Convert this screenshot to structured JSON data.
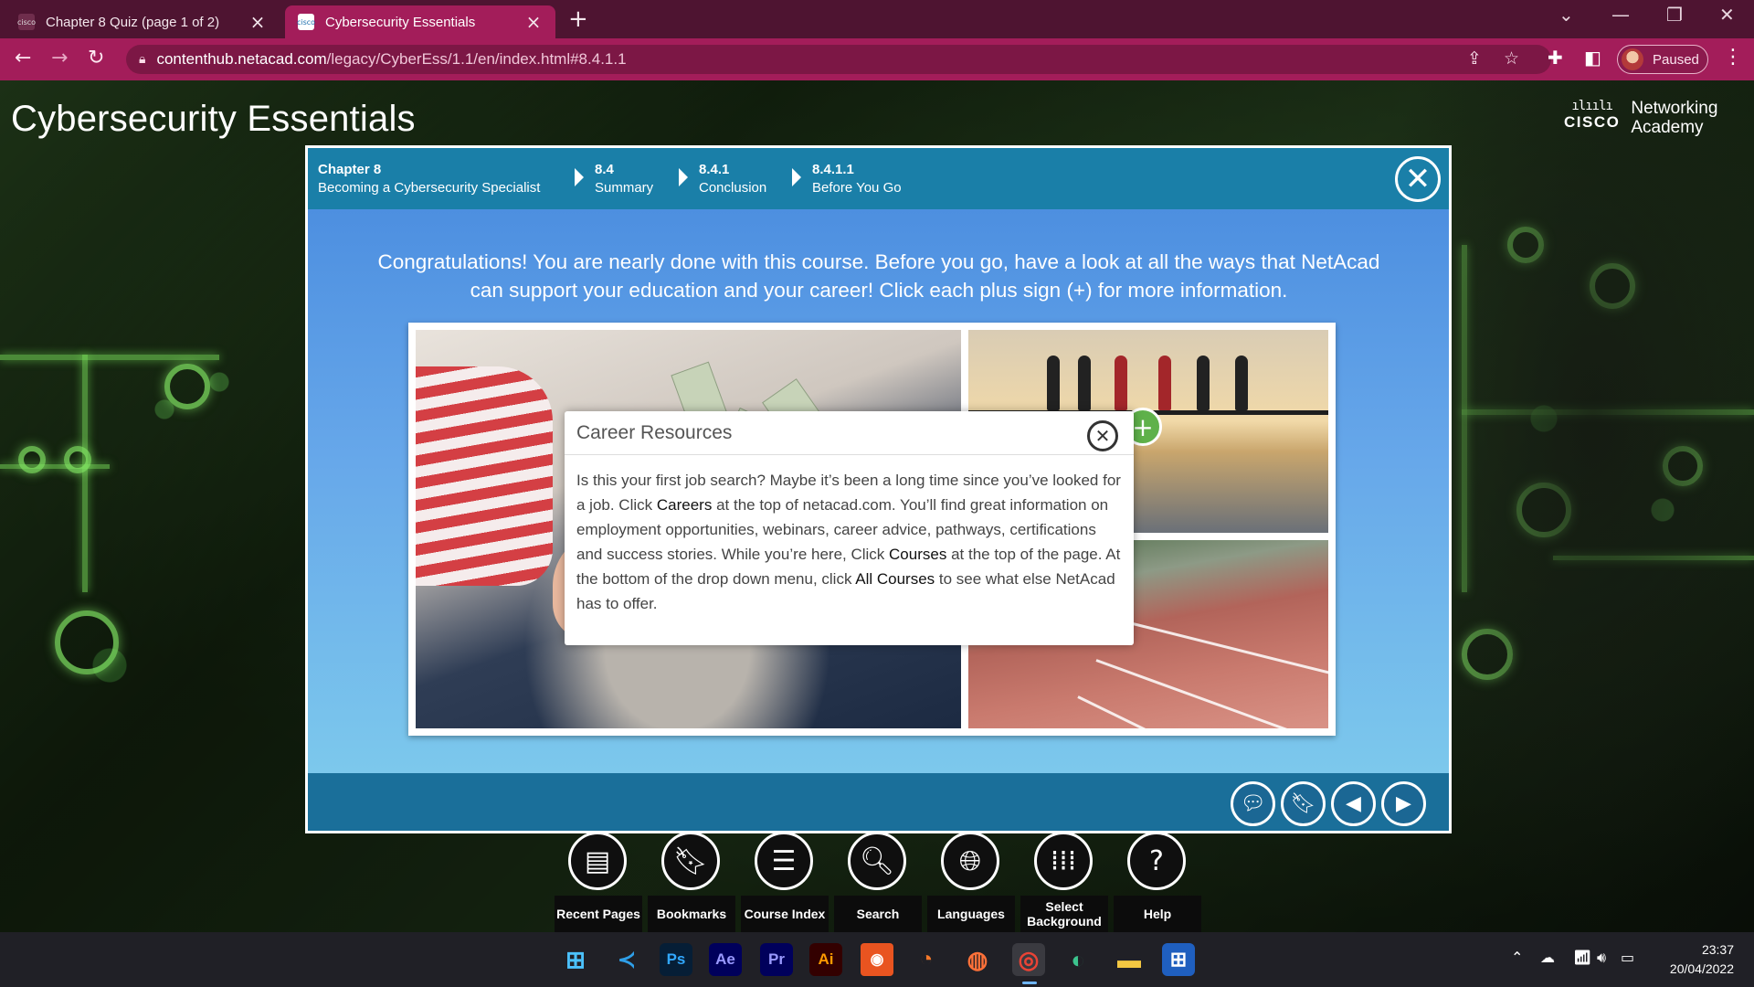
{
  "browser": {
    "tabs": [
      {
        "title": "Chapter 8 Quiz (page 1 of 2)",
        "favicon": "cisco"
      },
      {
        "title": "Cybersecurity Essentials",
        "favicon": "cisco"
      }
    ],
    "url_host": "contenthub.netacad.com",
    "url_path": "/legacy/CyberEss/1.1/en/index.html#8.4.1.1",
    "profile_label": "Paused"
  },
  "page": {
    "site_title": "Cybersecurity Essentials",
    "logo_brand": "CISCO",
    "logo_line1": "Networking",
    "logo_line2": "Academy"
  },
  "breadcrumb": [
    {
      "number": "Chapter 8",
      "title": "Becoming a Cybersecurity Specialist"
    },
    {
      "number": "8.4",
      "title": "Summary"
    },
    {
      "number": "8.4.1",
      "title": "Conclusion"
    },
    {
      "number": "8.4.1.1",
      "title": "Before You Go"
    }
  ],
  "content": {
    "intro": "Congratulations! You are nearly done with this course. Before you go, have a look at all the ways that NetAcad can support your education and your career! Click each plus sign (+) for more information.",
    "popup": {
      "title": "Career Resources",
      "text_1": "Is this your first job search? Maybe it’s been a long time since you’ve looked for a job. Click ",
      "bold_1": "Careers",
      "text_2": " at the top of netacad.com. You’ll find great information on employment opportunities, webinars, career advice, pathways, certifications and success stories. While you’re here, Click ",
      "bold_2": "Courses",
      "text_3": " at the top of the page. At the bottom of the drop down menu, click ",
      "bold_3": "All Courses",
      "text_4": " to see what else NetAcad has to offer."
    }
  },
  "toolbar": [
    {
      "label": "Recent Pages",
      "icon": "recent-pages-icon"
    },
    {
      "label": "Bookmarks",
      "icon": "bookmark-icon"
    },
    {
      "label": "Course Index",
      "icon": "menu-icon"
    },
    {
      "label": "Search",
      "icon": "search-icon"
    },
    {
      "label": "Languages",
      "icon": "globe-icon"
    },
    {
      "label": "Select Background",
      "icon": "grid-icon"
    },
    {
      "label": "Help",
      "icon": "help-icon"
    }
  ],
  "taskbar": {
    "apps": [
      "Windows",
      "VS Code",
      "Ps",
      "Ae",
      "Pr",
      "Ai",
      "Ubuntu",
      "Blender",
      "Firefox",
      "Chrome",
      "Edge",
      "File Explorer",
      "Microsoft Store"
    ],
    "time": "23:37",
    "date": "20/04/2022"
  },
  "colors": {
    "tab_strip": "#4e1431",
    "toolbar_accent": "#a31d5a",
    "header_blue": "#1a7fa8",
    "plus_green": "#5fb14a"
  }
}
